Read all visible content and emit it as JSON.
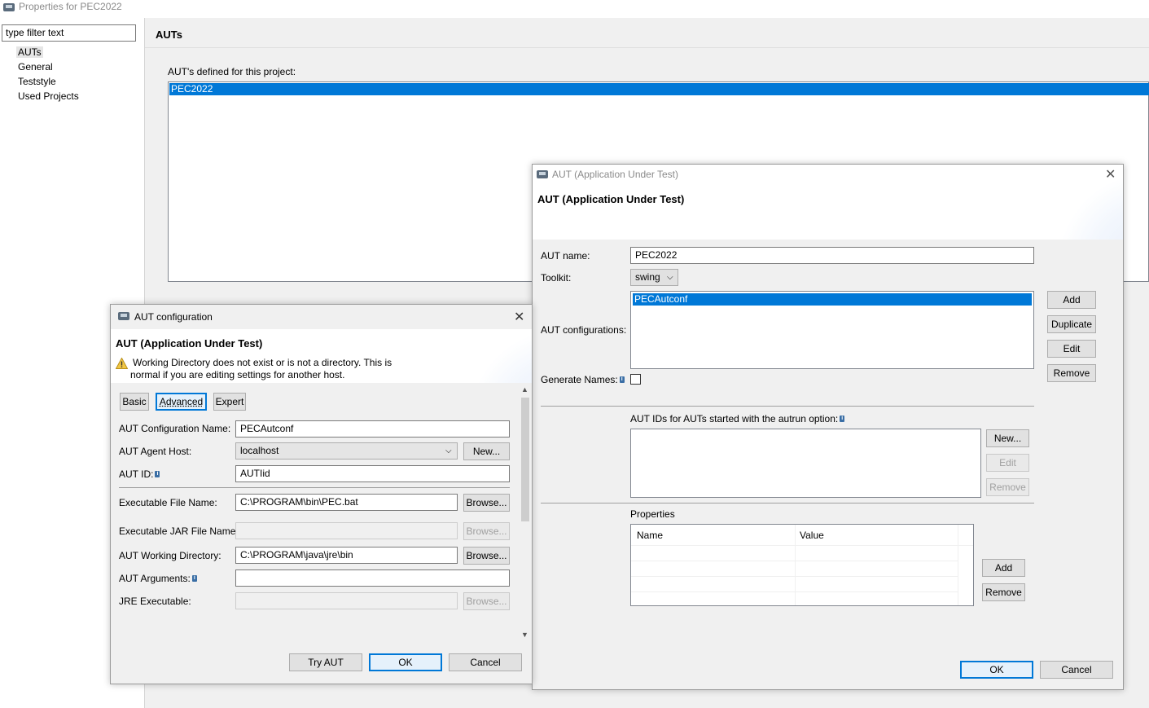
{
  "main_window": {
    "title": "Properties for PEC2022",
    "filter_placeholder": "type filter text",
    "tree": [
      "AUTs",
      "General",
      "Teststyle",
      "Used Projects"
    ],
    "page_title": "AUTs",
    "defined_label": "AUT's defined for this project:",
    "aut_list": [
      "PEC2022"
    ]
  },
  "aut_dialog": {
    "title": "AUT (Application Under Test)",
    "header": "AUT (Application Under Test)",
    "aut_name_label": "AUT name:",
    "aut_name_value": "PEC2022",
    "toolkit_label": "Toolkit:",
    "toolkit_value": "swing",
    "configs_label": "AUT configurations:",
    "configs": [
      "PECAutconf"
    ],
    "config_buttons": [
      "Add",
      "Duplicate",
      "Edit",
      "Remove"
    ],
    "generate_names_label": "Generate Names:",
    "autids_label": "AUT IDs for AUTs started with the autrun option:",
    "autid_buttons": [
      "New...",
      "Edit",
      "Remove"
    ],
    "properties_label": "Properties",
    "properties_columns": [
      "Name",
      "Value"
    ],
    "prop_buttons": [
      "Add",
      "Remove"
    ],
    "ok": "OK",
    "cancel": "Cancel"
  },
  "config_dialog": {
    "title": "AUT configuration",
    "header": "AUT (Application Under Test)",
    "warning_line1": "Working Directory does not exist or is not a directory. This is",
    "warning_line2": "normal if you are editing settings for another host.",
    "tabs": [
      "Basic",
      "Advanced",
      "Expert"
    ],
    "active_tab": "Advanced",
    "config_name_label": "AUT Configuration Name:",
    "config_name_value": "PECAutconf",
    "agent_host_label": "AUT Agent Host:",
    "agent_host_value": "localhost",
    "new_btn": "New...",
    "aut_id_label": "AUT ID:",
    "aut_id_value": "AUTIid",
    "exec_file_label": "Executable File Name:",
    "exec_file_value": "C:\\PROGRAM\\bin\\PEC.bat",
    "exec_jar_label": "Executable JAR File Name:",
    "working_dir_label": "AUT Working Directory:",
    "working_dir_value": "C:\\PROGRAM\\java\\jre\\bin",
    "arguments_label": "AUT Arguments:",
    "jre_label": "JRE Executable:",
    "browse": "Browse...",
    "try_aut": "Try AUT",
    "ok": "OK",
    "cancel": "Cancel"
  },
  "colors": {
    "selection": "#0078d7",
    "dialog_bg": "#f0f0f0",
    "warning": "#f2c744"
  }
}
